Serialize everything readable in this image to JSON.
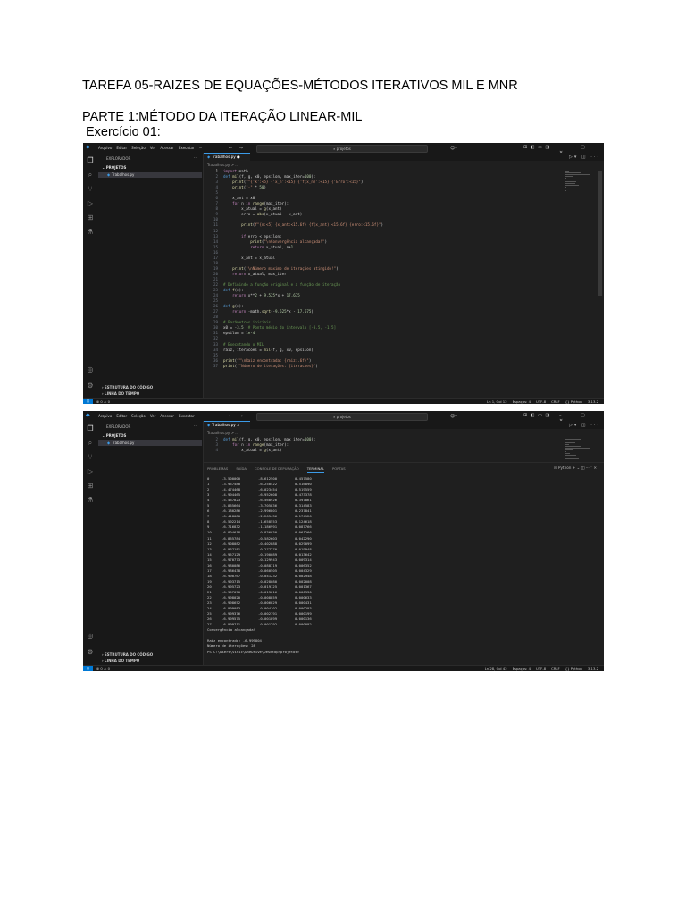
{
  "document": {
    "title": "TAREFA 05-RAIZES DE EQUAÇÕES-MÉTODOS ITERATIVOS MIL E MNR",
    "part": "PARTE 1:MÉTODO DA ITERAÇÃO LINEAR-MIL",
    "exercise": "Exercício 01:"
  },
  "vscode": {
    "menu": [
      "Arquivo",
      "Editar",
      "Seleção",
      "Ver",
      "Acessar",
      "Executar",
      "···"
    ],
    "search_text": "projetos",
    "explorer_label": "EXPLORADOR",
    "project_label": "PROJETOS",
    "file_name": "Trabalhos.py",
    "breadcrumb": "Trabalhos.py > ...",
    "outline_label": "ESTRUTURA DO CÓDIGO",
    "timeline_label": "LINHA DO TEMPO",
    "status_left": "⊗ 0 ⚠ 0",
    "status_right_1": [
      "Ln 1, Col 12",
      "Espaços: 4",
      "UTF-8",
      "CRLF",
      "{} Python",
      "3.13.2"
    ],
    "status_right_2": [
      "Ln 28, Col 42",
      "Espaços: 4",
      "UTF-8",
      "CRLF",
      "{} Python",
      "3.13.2"
    ],
    "panel_tabs": [
      "PROBLEMAS",
      "SAÍDA",
      "CONSOLE DE DEPURAÇÃO",
      "TERMINAL",
      "PORTAS"
    ],
    "panel_shell": "Python"
  },
  "code_lines": [
    "import math",
    "def mil(f, g, x0, epsilon, max_iter=100):",
    "    print(f\"{'k':<5} {'x_n':<15} {'f(x_n)':<15} {'Erro':<15}\")",
    "    print(\"-\" * 50)",
    "",
    "    x_ant = x0",
    "    for n in range(max_iter):",
    "        x_atual = g(x_ant)",
    "        erro = abs(x_atual - x_ant)",
    "",
    "        print(f\"{n:<5} {x_ant:<15.6f} {f(x_ant):<15.6f} {erro:<15.6f}\")",
    "",
    "        if erro < epsilon:",
    "            print(\"\\nConvergência alcançada!\")",
    "            return x_atual, n+1",
    "",
    "        x_ant = x_atual",
    "",
    "    print(\"\\nNúmero máximo de iterações atingido!\")",
    "    return x_atual, max_iter",
    "",
    "# Definindo a função original e a função de iteração",
    "def f(x):",
    "    return x**2 + 9.525*x + 17.675",
    "",
    "def g(x):",
    "    return -math.sqrt(-9.525*x - 17.675)",
    "",
    "# Parâmetros iniciais",
    "x0 = -3.5  # Ponto médio do intervalo [-3.5, -1.5]",
    "epsilon = 1e-4",
    "",
    "# Executando o MIL",
    "raiz, iteracoes = mil(f, g, x0, epsilon)",
    "",
    "print(f\"\\nRaiz encontrada: {raiz:.6f}\")",
    "print(f\"Número de iterações: {iteracoes}\")"
  ],
  "code_lines_2": [
    "def mil(f, g, x0, epsilon, max_iter=100):",
    "    for n in range(max_iter):",
    "        x_atual = g(x_ant)"
  ],
  "terminal_rows": [
    [
      "0",
      "-3.500000",
      "-8.612500",
      "0.457580"
    ],
    [
      "1",
      "-3.957580",
      "-6.250522",
      "0.516890"
    ],
    [
      "2",
      "-4.474468",
      "-6.023454",
      "0.519559"
    ],
    [
      "3",
      "-4.994465",
      "-6.952608",
      "0.473378"
    ],
    [
      "4",
      "-5.467823",
      "-6.568926",
      "0.397861"
    ],
    [
      "5",
      "-5.865664",
      "-3.705836",
      "0.314583"
    ],
    [
      "6",
      "-6.180286",
      "-2.996801",
      "0.237841"
    ],
    [
      "7",
      "-6.418080",
      "-2.265436",
      "0.174126"
    ],
    [
      "8",
      "-6.592214",
      "-1.658553",
      "0.124618"
    ],
    [
      "9",
      "-6.716832",
      "-1.186991",
      "0.087766"
    ],
    [
      "10",
      "-6.804618",
      "-0.836030",
      "0.061266"
    ],
    [
      "11",
      "-6.865784",
      "-0.582603",
      "0.042290"
    ],
    [
      "12",
      "-6.908082",
      "-0.402888",
      "0.029099"
    ],
    [
      "13",
      "-6.937181",
      "-0.277270",
      "0.019948"
    ],
    [
      "14",
      "-6.957129",
      "-0.190089",
      "0.013642"
    ],
    [
      "15",
      "-6.970773",
      "-0.129943",
      "0.009314"
    ],
    [
      "16",
      "-6.980086",
      "-0.088719",
      "0.006352"
    ],
    [
      "17",
      "-6.986438",
      "-0.060505",
      "0.004329"
    ],
    [
      "18",
      "-6.990767",
      "-0.041232",
      "0.002948"
    ],
    [
      "19",
      "-6.993715",
      "-0.028080",
      "0.002008"
    ],
    [
      "20",
      "-6.995723",
      "-0.019125",
      "0.001367"
    ],
    [
      "21",
      "-6.997090",
      "-0.013016",
      "0.000930"
    ],
    [
      "22",
      "-6.998020",
      "-0.008859",
      "0.000633"
    ],
    [
      "23",
      "-6.998652",
      "-0.006029",
      "0.000431"
    ],
    [
      "24",
      "-6.999083",
      "-0.004102",
      "0.000293"
    ],
    [
      "25",
      "-6.999376",
      "-0.002791",
      "0.000199"
    ],
    [
      "26",
      "-6.999575",
      "-0.001899",
      "0.000136"
    ],
    [
      "27",
      "-6.999711",
      "-0.001292",
      "0.000092"
    ]
  ],
  "terminal_tail": [
    "Convergência alcançada!",
    "",
    "Raiz encontrada: -6.999804",
    "Número de iterações: 28",
    "PS C:\\Users\\vinic\\OneDrive\\Desktop\\projetos>"
  ]
}
